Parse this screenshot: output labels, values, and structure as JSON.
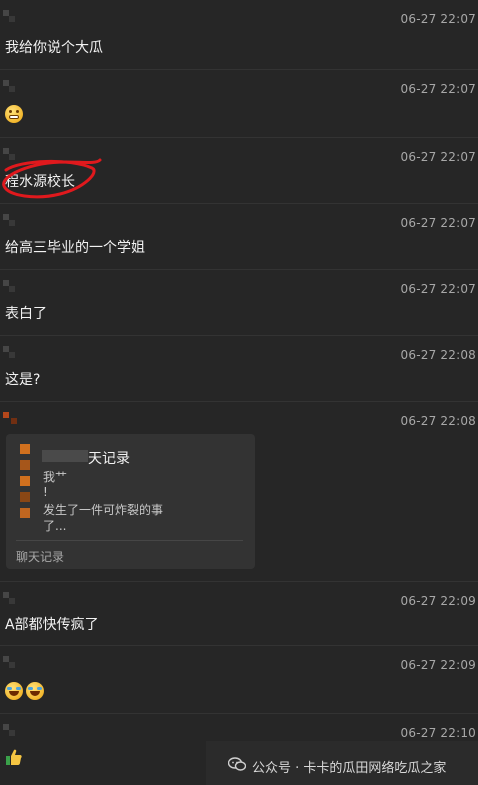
{
  "messages": [
    {
      "time": "06-27 22:07",
      "text": "我给你说个大瓜"
    },
    {
      "time": "06-27 22:07",
      "emoji": "grimacing-face-emoji"
    },
    {
      "time": "06-27 22:07",
      "text": "程水源校长"
    },
    {
      "time": "06-27 22:07",
      "text": "给高三毕业的一个学姐"
    },
    {
      "time": "06-27 22:07",
      "text": "表白了"
    },
    {
      "time": "06-27 22:08",
      "text": "这是?"
    },
    {
      "time": "06-27 22:08",
      "card": {
        "title": "天记录",
        "lines": [
          "我艹",
          "!",
          "发生了一件可炸裂的事",
          "了..."
        ],
        "footer": "聊天记录"
      }
    },
    {
      "time": "06-27 22:09",
      "text": "A部都快传疯了"
    },
    {
      "time": "06-27 22:09",
      "emoji": "crying-laughing-emoji"
    },
    {
      "time": "06-27 22:10",
      "emoji": "thumbs-up-emoji"
    }
  ],
  "watermark": {
    "text": "公众号 · 卡卡的瓜田网络吃瓜之家",
    "icon": "wechat-icon"
  },
  "colors": {
    "background": "#262626",
    "highlight": "#e0191d",
    "card": "#333333"
  }
}
